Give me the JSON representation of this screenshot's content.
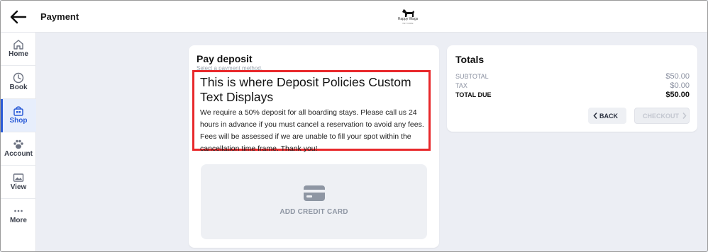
{
  "header": {
    "title": "Payment",
    "logo_text": "Happy Wags",
    "logo_subtext": "PET CARE"
  },
  "sidebar": {
    "items": [
      {
        "label": "Home",
        "icon": "home-icon"
      },
      {
        "label": "Book",
        "icon": "clock-icon"
      },
      {
        "label": "Shop",
        "icon": "shop-icon",
        "active": true
      },
      {
        "label": "Account",
        "icon": "paw-icon"
      },
      {
        "label": "View",
        "icon": "image-icon"
      },
      {
        "label": "More",
        "icon": "ellipsis-icon"
      }
    ]
  },
  "deposit": {
    "title": "Pay deposit",
    "subtitle": "Select a payment method.",
    "policy_heading": "This is where Deposit Policies Custom Text Displays",
    "policy_body": "We require a 50% deposit for all boarding stays. Please call us 24 hours in advance if you must cancel a reservation to avoid any fees. Fees will be assessed if we are unable to fill your spot within the cancellation time frame. Thank you!",
    "add_card_label": "ADD CREDIT CARD"
  },
  "totals": {
    "title": "Totals",
    "rows": [
      {
        "label": "SUBTOTAL",
        "value": "$50.00"
      },
      {
        "label": "TAX",
        "value": "$0.00"
      },
      {
        "label": "TOTAL DUE",
        "value": "$50.00"
      }
    ],
    "back_label": "BACK",
    "checkout_label": "CHECKOUT"
  },
  "colors": {
    "accent": "#2a5bd7",
    "highlight_border": "#e8282b",
    "background": "#eceef4"
  }
}
